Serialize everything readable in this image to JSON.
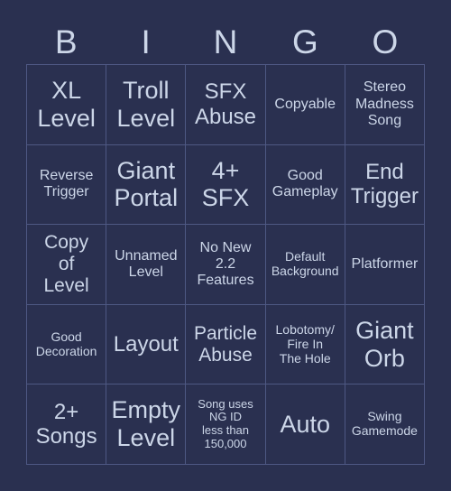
{
  "header": {
    "letters": [
      "B",
      "I",
      "N",
      "G",
      "O"
    ]
  },
  "colors": {
    "background": "#2a3050",
    "cell_background": "#2a3050",
    "border": "#4e5883",
    "text": "#ccd6e8"
  },
  "grid": {
    "columns": 5,
    "rows": 5,
    "cells": [
      [
        {
          "text": "XL\nLevel",
          "size": "fs-xxl"
        },
        {
          "text": "Troll\nLevel",
          "size": "fs-xxl"
        },
        {
          "text": "SFX\nAbuse",
          "size": "fs-xl"
        },
        {
          "text": "Copyable",
          "size": "fs-md"
        },
        {
          "text": "Stereo\nMadness\nSong",
          "size": "fs-md"
        }
      ],
      [
        {
          "text": "Reverse\nTrigger",
          "size": "fs-md"
        },
        {
          "text": "Giant\nPortal",
          "size": "fs-xxl"
        },
        {
          "text": "4+\nSFX",
          "size": "fs-xxl"
        },
        {
          "text": "Good\nGameplay",
          "size": "fs-md"
        },
        {
          "text": "End\nTrigger",
          "size": "fs-xl"
        }
      ],
      [
        {
          "text": "Copy\nof\nLevel",
          "size": "fs-lg"
        },
        {
          "text": "Unnamed\nLevel",
          "size": "fs-md"
        },
        {
          "text": "No New\n2.2\nFeatures",
          "size": "fs-md"
        },
        {
          "text": "Default\nBackground",
          "size": "fs-sm"
        },
        {
          "text": "Platformer",
          "size": "fs-md"
        }
      ],
      [
        {
          "text": "Good\nDecoration",
          "size": "fs-sm"
        },
        {
          "text": "Layout",
          "size": "fs-xl"
        },
        {
          "text": "Particle\nAbuse",
          "size": "fs-lg"
        },
        {
          "text": "Lobotomy/\nFire In\nThe Hole",
          "size": "fs-sm"
        },
        {
          "text": "Giant\nOrb",
          "size": "fs-xxl"
        }
      ],
      [
        {
          "text": "2+\nSongs",
          "size": "fs-xl"
        },
        {
          "text": "Empty\nLevel",
          "size": "fs-xxl"
        },
        {
          "text": "Song uses\nNG ID\nless than\n150,000",
          "size": "fs-xs"
        },
        {
          "text": "Auto",
          "size": "fs-xxl"
        },
        {
          "text": "Swing\nGamemode",
          "size": "fs-sm"
        }
      ]
    ]
  }
}
